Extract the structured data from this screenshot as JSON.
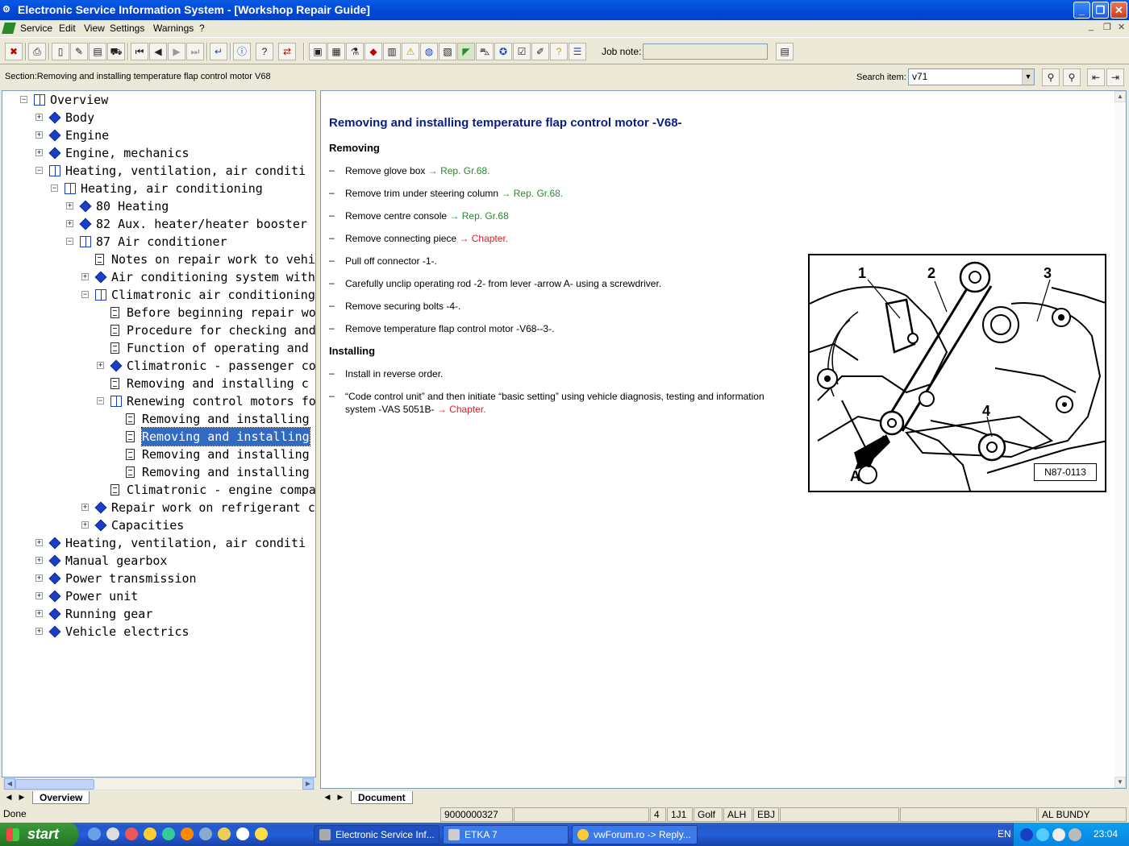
{
  "window": {
    "title": "Electronic Service Information System - [Workshop Repair Guide]"
  },
  "menu": [
    "Service",
    "Edit",
    "View",
    "Settings",
    "Warnings",
    "?"
  ],
  "toolbar": {
    "job_note_label": "Job note:",
    "job_note_value": ""
  },
  "section_line": "Section:Removing and installing  temperature flap control motor V68",
  "search": {
    "label": "Search item:",
    "value": "v71"
  },
  "tree": [
    {
      "label": "Overview",
      "level": 0,
      "icon": "open-book-icon",
      "expander": "-"
    },
    {
      "label": "Body",
      "level": 1,
      "icon": "book-icon",
      "expander": "+"
    },
    {
      "label": "Engine",
      "level": 1,
      "icon": "book-icon",
      "expander": "+"
    },
    {
      "label": "Engine, mechanics",
      "level": 1,
      "icon": "book-icon",
      "expander": "+"
    },
    {
      "label": "Heating, ventilation, air conditi",
      "level": 1,
      "icon": "open-book-icon",
      "expander": "-"
    },
    {
      "label": "Heating, air conditioning",
      "level": 2,
      "icon": "open-book-icon",
      "expander": "-"
    },
    {
      "label": "80 Heating",
      "level": 3,
      "icon": "book-icon",
      "expander": "+"
    },
    {
      "label": "82 Aux. heater/heater booster",
      "level": 3,
      "icon": "book-icon",
      "expander": "+"
    },
    {
      "label": "87 Air conditioner",
      "level": 3,
      "icon": "open-book-icon",
      "expander": "-"
    },
    {
      "label": "Notes on repair work to vehi",
      "level": 4,
      "icon": "document-icon",
      "expander": ""
    },
    {
      "label": "Air conditioning system with",
      "level": 4,
      "icon": "book-icon",
      "expander": "+"
    },
    {
      "label": "Climatronic air conditioning",
      "level": 4,
      "icon": "open-book-icon",
      "expander": "-"
    },
    {
      "label": "Before beginning repair wo",
      "level": 5,
      "icon": "document-icon",
      "expander": ""
    },
    {
      "label": "Procedure for checking and",
      "level": 5,
      "icon": "document-icon",
      "expander": ""
    },
    {
      "label": "Function of  operating and",
      "level": 5,
      "icon": "document-icon",
      "expander": ""
    },
    {
      "label": "Climatronic - passenger co",
      "level": 5,
      "icon": "book-icon",
      "expander": "+"
    },
    {
      "label": "Removing and installing  c",
      "level": 5,
      "icon": "document-icon",
      "expander": ""
    },
    {
      "label": "Renewing control motors fo",
      "level": 5,
      "icon": "open-book-icon",
      "expander": "-"
    },
    {
      "label": "Removing and installing",
      "level": 6,
      "icon": "document-icon",
      "expander": ""
    },
    {
      "label": "Removing and installing",
      "level": 6,
      "icon": "document-icon",
      "expander": "",
      "selected": true
    },
    {
      "label": "Removing and installing",
      "level": 6,
      "icon": "document-icon",
      "expander": ""
    },
    {
      "label": "Removing and installing",
      "level": 6,
      "icon": "document-icon",
      "expander": ""
    },
    {
      "label": "Climatronic - engine compa",
      "level": 5,
      "icon": "document-icon",
      "expander": ""
    },
    {
      "label": "Repair work on refrigerant c",
      "level": 4,
      "icon": "book-icon",
      "expander": "+"
    },
    {
      "label": "Capacities",
      "level": 4,
      "icon": "book-icon",
      "expander": "+"
    },
    {
      "label": "Heating, ventilation, air conditi",
      "level": 1,
      "icon": "book-icon",
      "expander": "+"
    },
    {
      "label": "Manual gearbox",
      "level": 1,
      "icon": "book-icon",
      "expander": "+"
    },
    {
      "label": "Power transmission",
      "level": 1,
      "icon": "book-icon",
      "expander": "+"
    },
    {
      "label": "Power unit",
      "level": 1,
      "icon": "book-icon",
      "expander": "+"
    },
    {
      "label": "Running gear",
      "level": 1,
      "icon": "book-icon",
      "expander": "+"
    },
    {
      "label": "Vehicle electrics",
      "level": 1,
      "icon": "book-icon",
      "expander": "+"
    }
  ],
  "tabs": {
    "tree": "Overview",
    "doc": "Document"
  },
  "document": {
    "title": "Removing and installing temperature flap control motor -V68-",
    "removing_heading": "Removing",
    "removing_steps": [
      {
        "text": "Remove glove box ",
        "link": "→ Rep. Gr.68.",
        "link_color": "green"
      },
      {
        "text": "Remove trim under steering column ",
        "link": "→ Rep. Gr.68.",
        "link_color": "green"
      },
      {
        "text": "Remove centre console ",
        "link": "→ Rep. Gr.68",
        "link_color": "green"
      },
      {
        "text": "Remove connecting piece ",
        "link": "→ Chapter.",
        "link_color": "red"
      },
      {
        "text": "Pull off connector -1-.",
        "link": "",
        "link_color": ""
      },
      {
        "text": "Carefully unclip operating rod -2- from lever -arrow A- using a screwdriver.",
        "link": "",
        "link_color": ""
      },
      {
        "text": "Remove securing bolts -4-.",
        "link": "",
        "link_color": ""
      },
      {
        "text": "Remove temperature flap control motor -V68--3-.",
        "link": "",
        "link_color": ""
      }
    ],
    "installing_heading": "Installing",
    "installing_steps": [
      {
        "text": "Install in reverse order.",
        "link": "",
        "link_color": ""
      },
      {
        "text": "“Code control unit” and then initiate “basic setting” using vehicle diagnosis, testing and information system -VAS 5051B- ",
        "link": "→ Chapter.",
        "link_color": "red"
      }
    ],
    "dash": "–",
    "figure": {
      "callouts": [
        "1",
        "2",
        "3",
        "4",
        "A"
      ],
      "code": "N87-0113"
    }
  },
  "status": {
    "state": "Done",
    "number": "9000000327",
    "f1": "4",
    "f2": "1J1",
    "f3": "Golf",
    "f4": "ALH",
    "f5": "EBJ",
    "user": "AL BUNDY"
  },
  "taskbar": {
    "start": "start",
    "tasks": [
      "Electronic Service Inf...",
      "ETKA 7",
      "vwForum.ro -> Reply..."
    ],
    "lang": "EN",
    "clock": "23:04"
  },
  "colors": {
    "title_blue": "#0a1e7d",
    "link_green": "#2b8a2b",
    "link_red": "#d4202a",
    "selection": "#316ac5"
  }
}
